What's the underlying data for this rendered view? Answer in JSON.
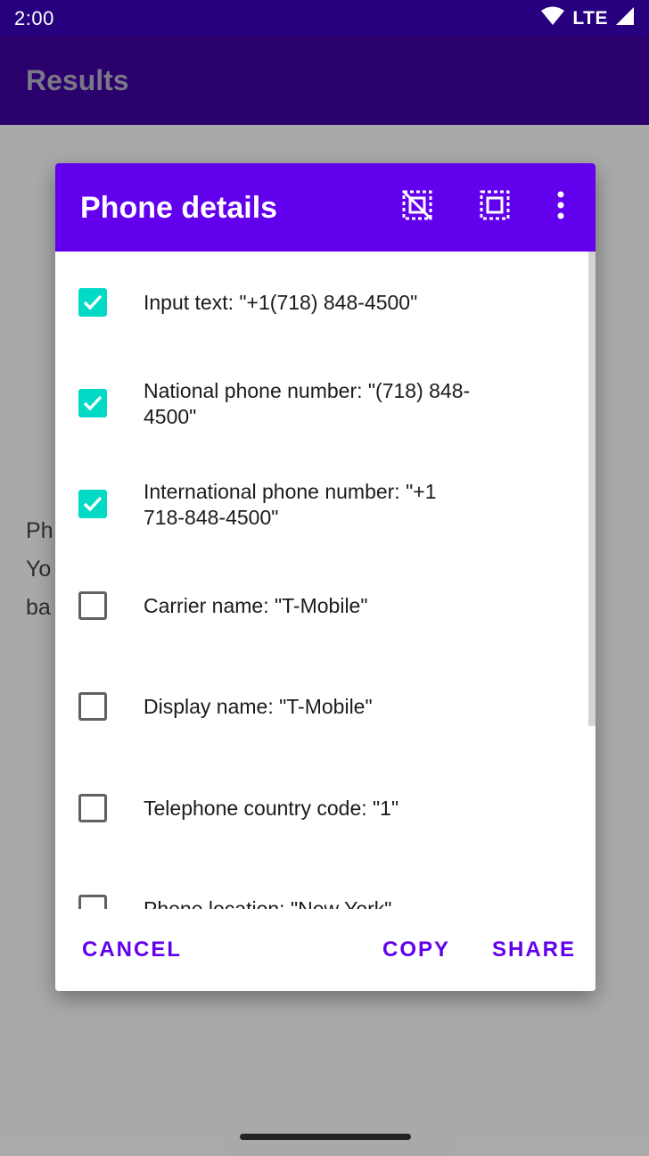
{
  "status_bar": {
    "time": "2:00",
    "network": "LTE",
    "icons": [
      "wifi-icon",
      "cell-signal-icon"
    ]
  },
  "app_bar": {
    "title": "Results"
  },
  "background": {
    "lines": [
      "Ph",
      "Yo",
      "ba"
    ]
  },
  "dialog": {
    "title": "Phone details",
    "header_icons": [
      "deselect-all-icon",
      "select-all-icon",
      "more-vert-icon"
    ],
    "items": [
      {
        "label": "Input text: \"+1(718) 848-4500\"",
        "checked": true
      },
      {
        "label": "National phone number: \"(718) 848-4500\"",
        "checked": true
      },
      {
        "label": "International phone number: \"+1 718-848-4500\"",
        "checked": true
      },
      {
        "label": "Carrier name: \"T-Mobile\"",
        "checked": false
      },
      {
        "label": "Display name: \"T-Mobile\"",
        "checked": false
      },
      {
        "label": "Telephone country code: \"1\"",
        "checked": false
      },
      {
        "label": "Phone location: \"New York\"",
        "checked": false
      }
    ],
    "actions": {
      "cancel": "CANCEL",
      "copy": "COPY",
      "share": "SHARE"
    }
  },
  "colors": {
    "primary": "#6200ee",
    "primary_dark": "#3700b3",
    "accent": "#03dac6"
  }
}
